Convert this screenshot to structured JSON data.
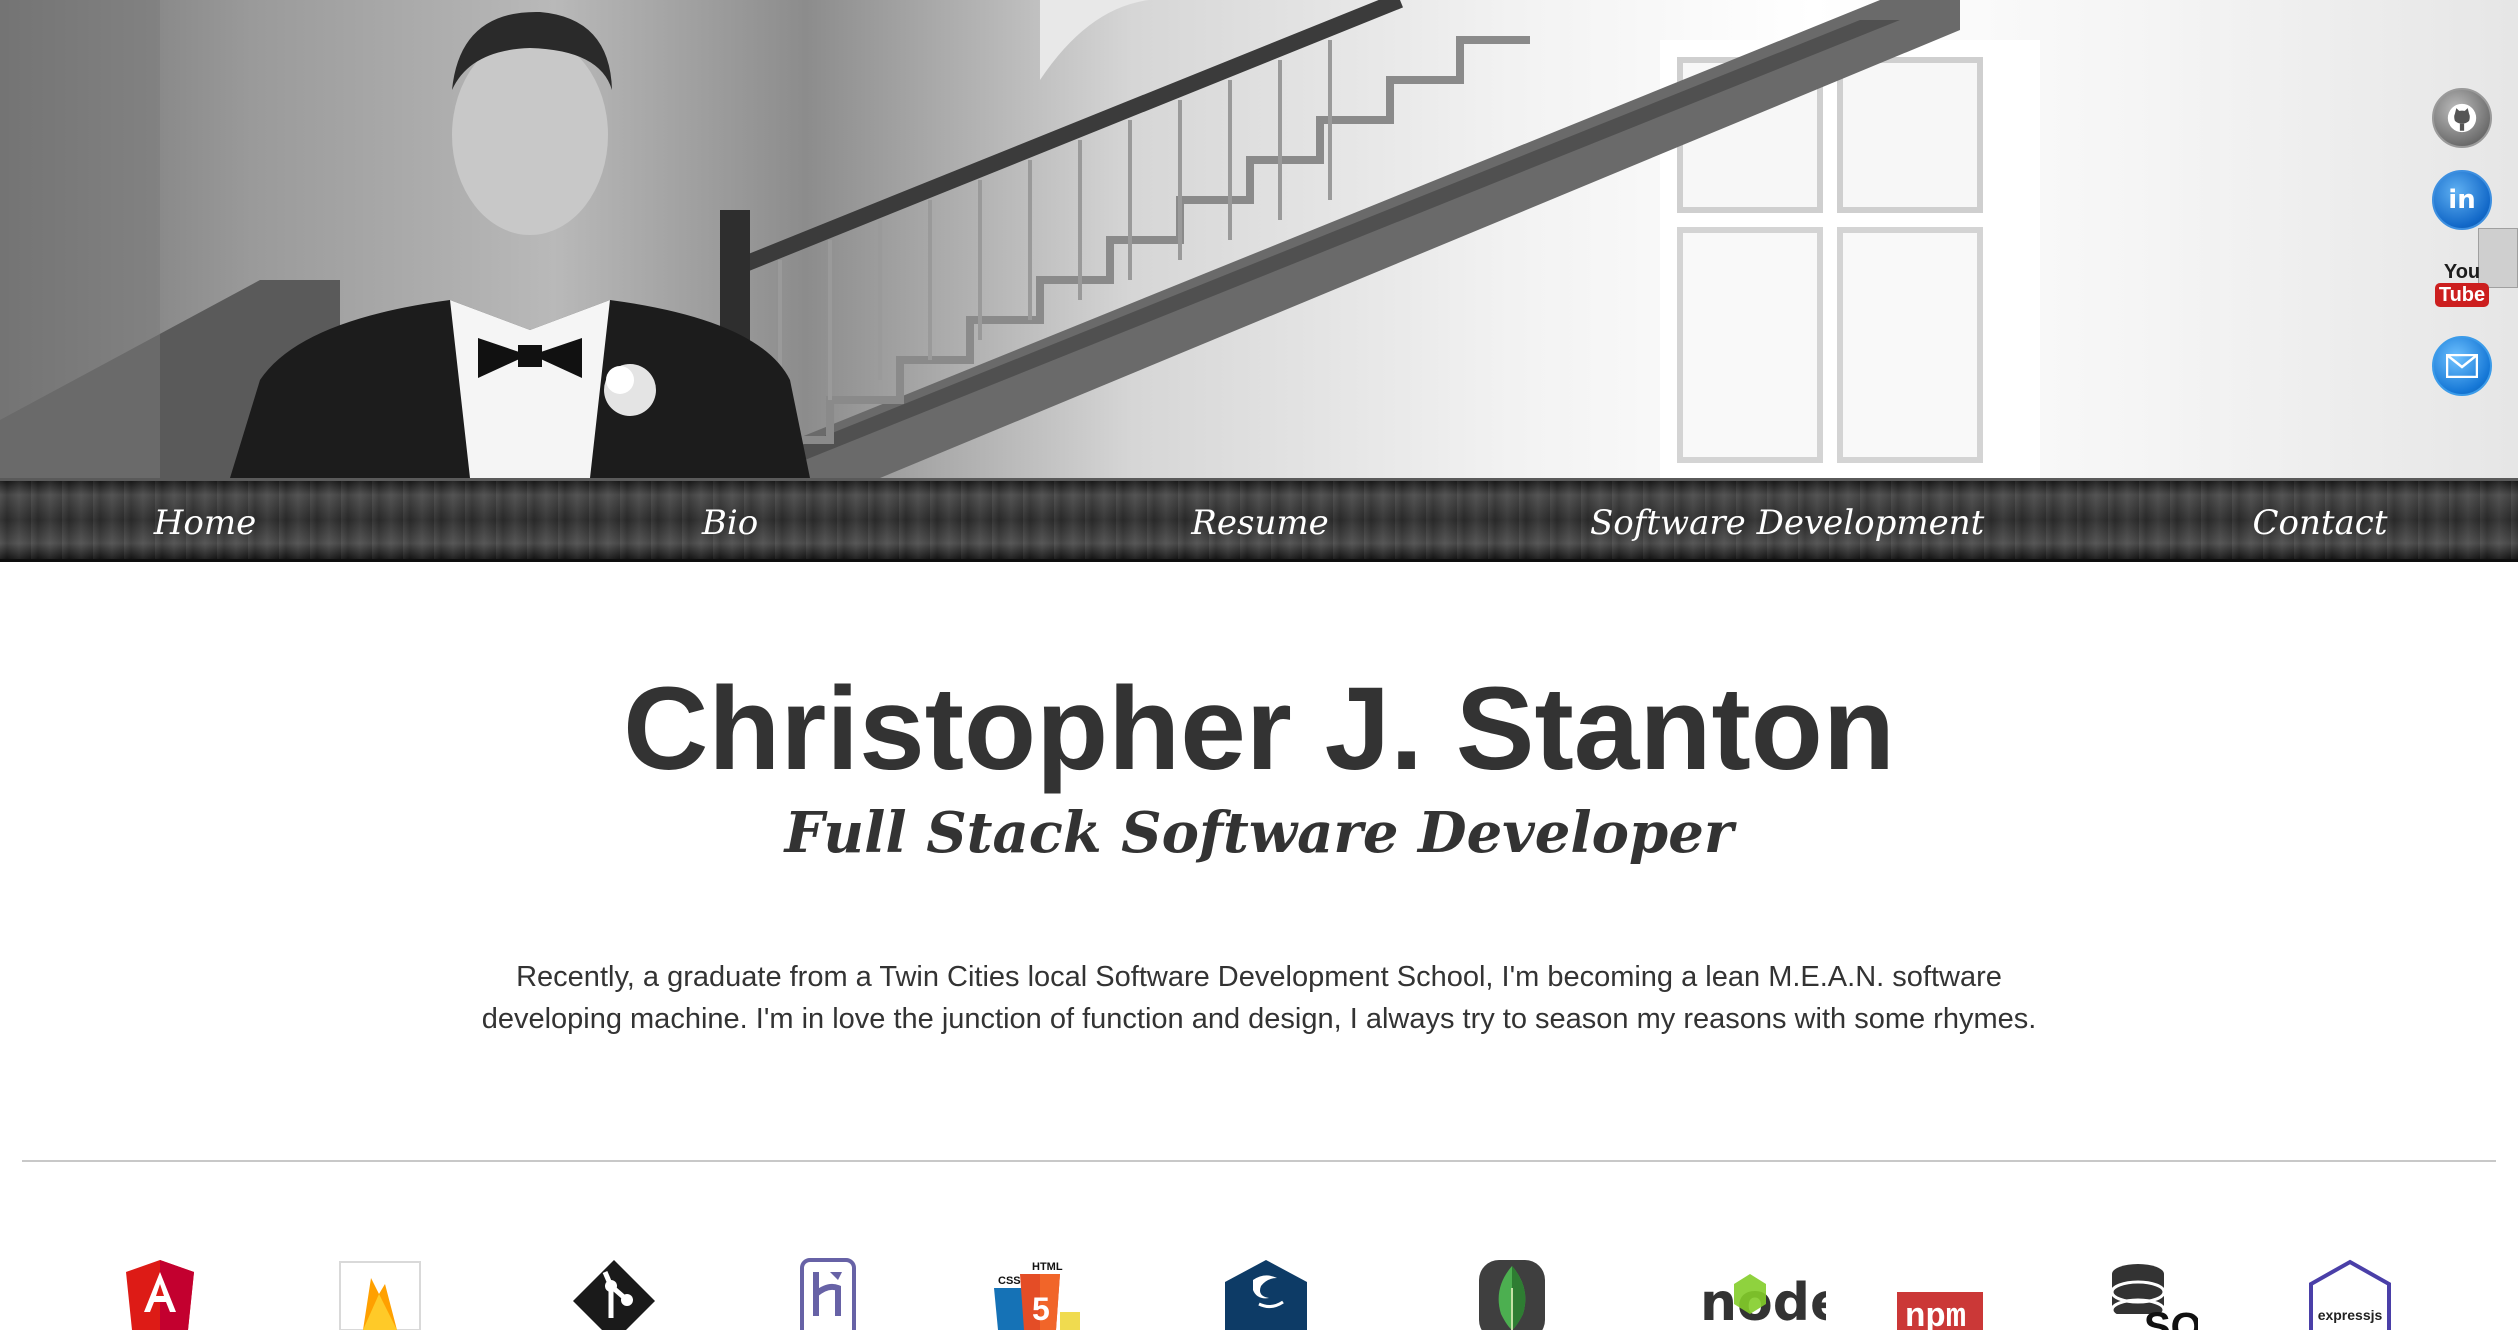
{
  "hero": {
    "photo_description_icon": "portrait-photo"
  },
  "social": {
    "github_icon": "github-icon",
    "linkedin_label": "in",
    "youtube_you": "You",
    "youtube_tube": "Tube",
    "email_icon": "email-icon"
  },
  "nav": {
    "items": [
      {
        "label": "Home"
      },
      {
        "label": "Bio"
      },
      {
        "label": "Resume"
      },
      {
        "label": "Software Development"
      },
      {
        "label": "Contact"
      }
    ]
  },
  "main": {
    "name": "Christopher J. Stanton",
    "subtitle": "Full Stack Software Developer",
    "bio": "Recently, a graduate from a Twin Cities local Software Development School, I'm becoming a lean M.E.A.N. software developing machine. I'm in love the junction of function and design, I always try to season my reasons with some rhymes."
  },
  "tech": {
    "html5_label": "HTML",
    "css_label": "CSS",
    "node_label": "node",
    "npm_label": "npm",
    "sql_label": "SQL",
    "express_label": "expressjs",
    "icons": [
      "angular-icon",
      "firebase-icon",
      "git-icon",
      "heroku-icon",
      "html5-css3-icon",
      "jquery-icon",
      "mongodb-icon",
      "nodejs-icon",
      "npm-icon",
      "sql-database-icon",
      "expressjs-icon"
    ]
  },
  "colors": {
    "text": "#333333",
    "nav_text": "#ffffff",
    "linkedin": "#1268c8",
    "youtube_red": "#cc1f1f",
    "angular_red": "#dd1b16",
    "firebase_yellow": "#ffca28",
    "mongodb_green": "#4caf50",
    "npm_red": "#cb3837"
  }
}
